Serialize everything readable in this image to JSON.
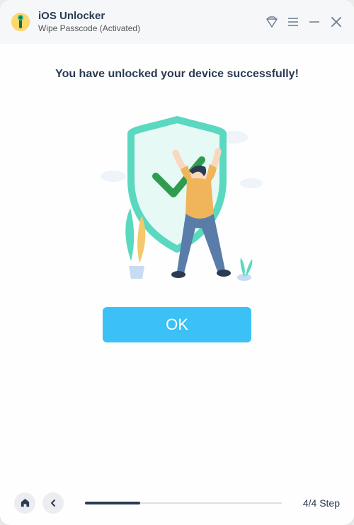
{
  "header": {
    "title": "iOS Unlocker",
    "subtitle_mode": "Wipe Passcode",
    "subtitle_status": "(Activated)"
  },
  "main": {
    "headline": "You have unlocked your device successfully!",
    "ok_label": "OK"
  },
  "footer": {
    "step_current": "4",
    "step_total": "4",
    "step_label": "Step"
  }
}
